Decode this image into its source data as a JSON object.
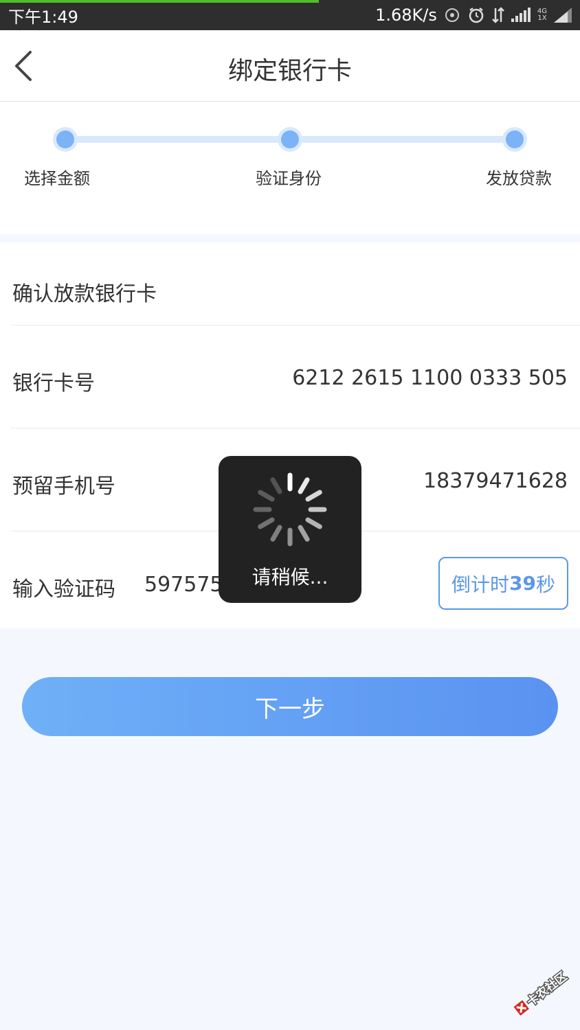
{
  "status_bar": {
    "time": "下午1:49",
    "net_speed": "1.68K/s",
    "net_type": "4G",
    "net_type2": "1X",
    "load_progress": 0.55
  },
  "header": {
    "title": "绑定银行卡"
  },
  "steps": [
    {
      "label": "选择金额"
    },
    {
      "label": "验证身份"
    },
    {
      "label": "发放贷款"
    }
  ],
  "card": {
    "title": "确认放款银行卡",
    "bank_card_label": "银行卡号",
    "bank_card_number": "6212 2615 1100 0333 505",
    "phone_label": "预留手机号",
    "phone_number": "18379471628",
    "code_label": "输入验证码",
    "code_value": "597575",
    "countdown_prefix": "倒计时",
    "countdown_seconds": "39",
    "countdown_suffix": "秒"
  },
  "next_button": {
    "label": "下一步"
  },
  "toast": {
    "text": "请稍候..."
  },
  "watermark": {
    "text": "卡农社区"
  },
  "colors": {
    "accent": "#5b97ea",
    "step": "#7cb2f6",
    "progress": "#4fbd2a",
    "toast_bg": "#222222"
  }
}
